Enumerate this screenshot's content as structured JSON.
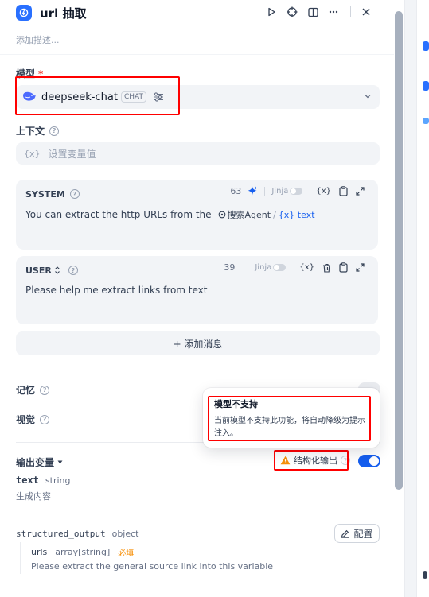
{
  "header": {
    "title": "url 抽取",
    "description_placeholder": "添加描述..."
  },
  "model": {
    "label": "模型",
    "required_mark": "*",
    "name": "deepseek-chat",
    "tag": "CHAT"
  },
  "context": {
    "label": "上下文",
    "var_icon": "{x}",
    "placeholder": "设置变量值"
  },
  "system_message": {
    "role": "SYSTEM",
    "token_count": "63",
    "jinja_label": "Jinja",
    "text": "You can extract the http URLs from the",
    "ref_node": "搜索Agent",
    "ref_separator": "/",
    "ref_var": "{x} text"
  },
  "user_message": {
    "role": "USER",
    "token_count": "39",
    "jinja_label": "Jinja",
    "text": "Please help me extract links from text"
  },
  "add_message": {
    "label": "+ 添加消息"
  },
  "memory": {
    "label": "记忆"
  },
  "vision": {
    "label": "视觉"
  },
  "tooltip": {
    "title": "模型不支持",
    "body": "当前模型不支持此功能，将自动降级为提示注入。"
  },
  "output": {
    "label": "输出变量",
    "structured_label": "结构化输出",
    "structured_enabled": true,
    "vars": [
      {
        "name": "text",
        "type": "string",
        "desc": "生成内容"
      }
    ],
    "structured": {
      "name": "structured_output",
      "type": "object",
      "config_label": "配置",
      "child": {
        "name": "urls",
        "type": "array[string]",
        "required": "必填",
        "desc": "Please extract the general source link into this variable"
      }
    }
  },
  "colors": {
    "accent": "#155eef",
    "warning": "#f79009",
    "highlight": "#ff0000"
  }
}
